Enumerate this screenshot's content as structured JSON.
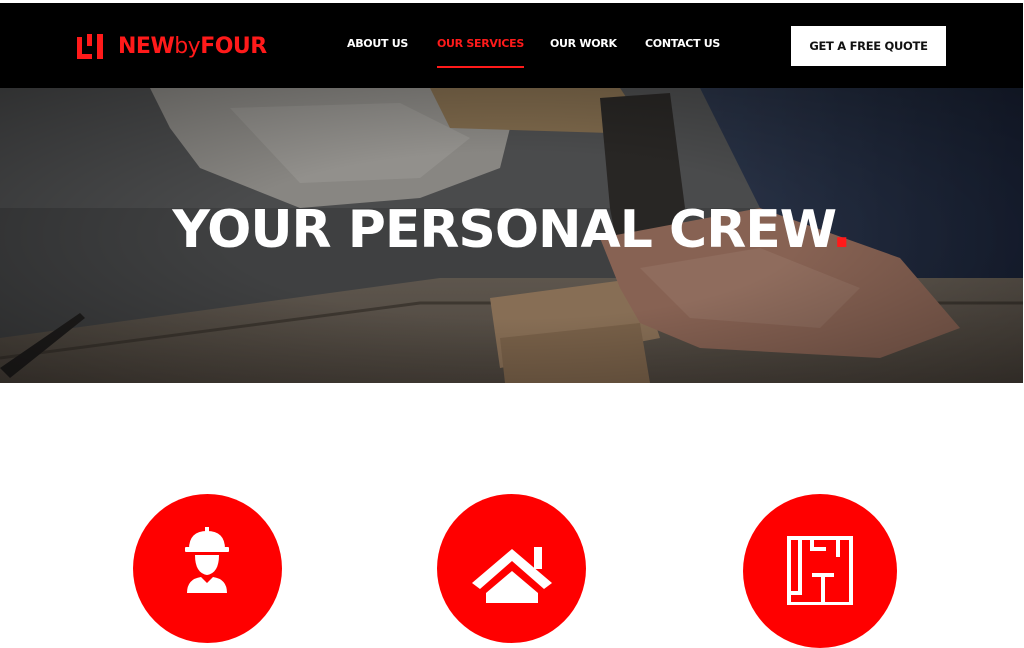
{
  "brand": {
    "logo_text_new": "NEW",
    "logo_text_by": "by",
    "logo_text_four": "FOUR",
    "accent_color": "#ff1a1a"
  },
  "nav": {
    "items": [
      {
        "label": "ABOUT US",
        "active": false
      },
      {
        "label": "OUR SERVICES",
        "active": true
      },
      {
        "label": "OUR WORK",
        "active": false
      },
      {
        "label": "CONTACT US",
        "active": false
      }
    ],
    "cta_label": "GET A FREE QUOTE"
  },
  "hero": {
    "title": "YOUR PERSONAL CREW",
    "title_punctuation": "."
  },
  "services": {
    "icons": [
      "construction-worker-icon",
      "house-icon",
      "floor-plan-icon"
    ]
  }
}
